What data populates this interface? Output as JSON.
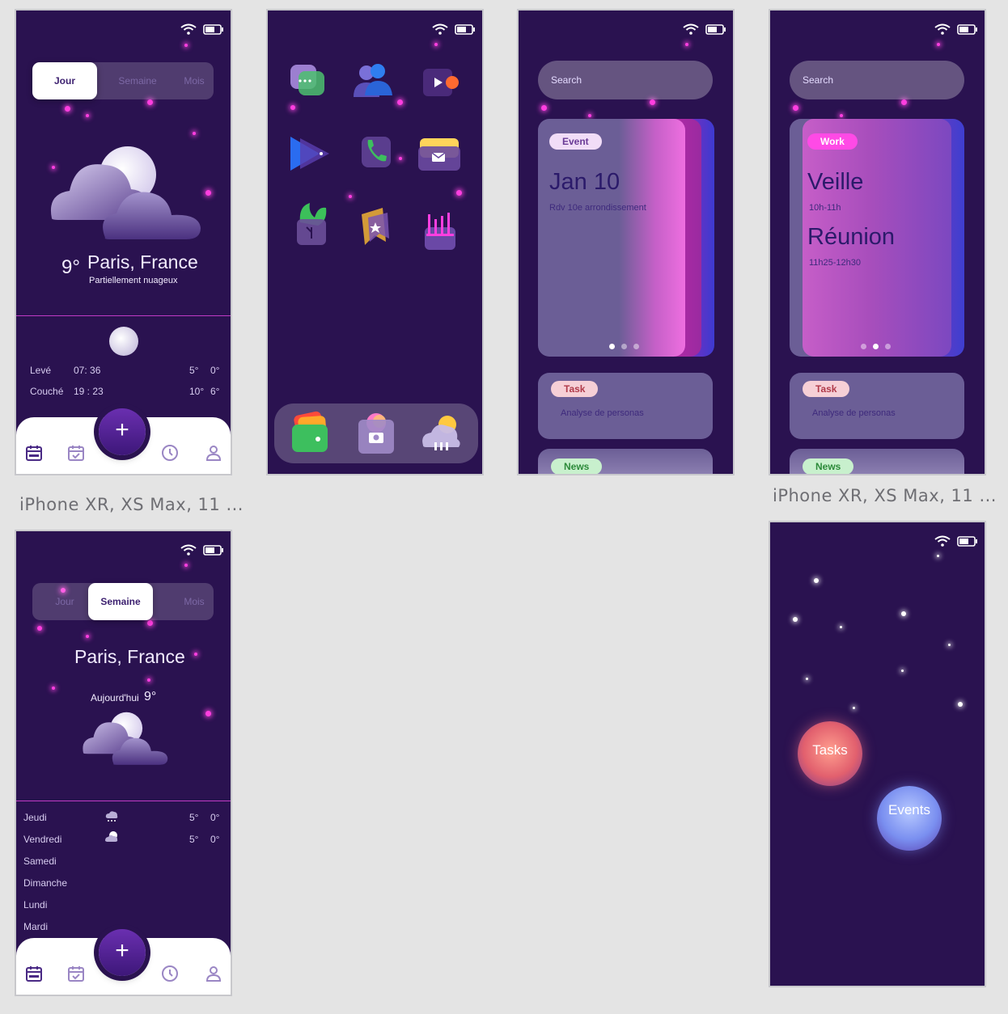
{
  "labels": {
    "artboard_1": "iPhone XR, XS Max, 11 ...",
    "artboard_4": "iPhone XR, XS Max, 11 ..."
  },
  "colors": {
    "background": "#2a1250",
    "accent_pink": "#ff3ee0",
    "canvas": "#e4e4e4"
  },
  "screen_day": {
    "segments": [
      "Jour",
      "Semaine",
      "Mois"
    ],
    "active_segment": "Jour",
    "temperature": "9°",
    "city": "Paris, France",
    "condition": "Partiellement nuageux",
    "rows": [
      {
        "label": "Levé",
        "time": "07: 36",
        "t1": "5°",
        "t2": "0°"
      },
      {
        "label": "Couché",
        "time": "19 : 23",
        "t1": "10°",
        "t2": "6°"
      }
    ],
    "fab_label": "+",
    "nav_icons": [
      "calendar-icon",
      "calendar-check-icon",
      "clock-icon",
      "user-icon"
    ]
  },
  "screen_week": {
    "segments": [
      "Jour",
      "Semaine",
      "Mois"
    ],
    "active_segment": "Semaine",
    "city": "Paris, France",
    "today_label": "Aujourd'hui",
    "today_temp": "9°",
    "days": [
      {
        "name": "Jeudi",
        "t1": "5°",
        "t2": "0°",
        "icon": "snow-cloud-icon"
      },
      {
        "name": "Vendredi",
        "t1": "5°",
        "t2": "0°",
        "icon": "cloud-moon-icon"
      },
      {
        "name": "Samedi"
      },
      {
        "name": "Dimanche"
      },
      {
        "name": "Lundi"
      },
      {
        "name": "Mardi"
      }
    ],
    "fab_label": "+"
  },
  "screen_apps": {
    "icons": [
      "chat-app-icon",
      "contacts-app-icon",
      "video-app-icon",
      "play-app-icon",
      "phone-app-icon",
      "mail-app-icon",
      "leaf-app-icon",
      "bookmark-app-icon",
      "stats-app-icon"
    ],
    "dock": [
      "wallet-app-icon",
      "camera-app-icon",
      "weather-app-icon"
    ]
  },
  "screen_event": {
    "search_placeholder": "Search",
    "card_tag": "Event",
    "card_title": "Jan 10",
    "card_subtitle": "Rdv 10e arrondissement",
    "task_tag": "Task",
    "task_text": "Analyse de personas",
    "news_tag": "News"
  },
  "screen_work": {
    "search_placeholder": "Search",
    "card_tag": "Work",
    "item1_title": "Veille",
    "item1_time": "10h-11h",
    "item2_title": "Réunion",
    "item2_time": "11h25-12h30",
    "task_tag": "Task",
    "task_text": "Analyse de personas",
    "news_tag": "News"
  },
  "screen_bubbles": {
    "tasks_label": "Tasks",
    "events_label": "Events"
  }
}
